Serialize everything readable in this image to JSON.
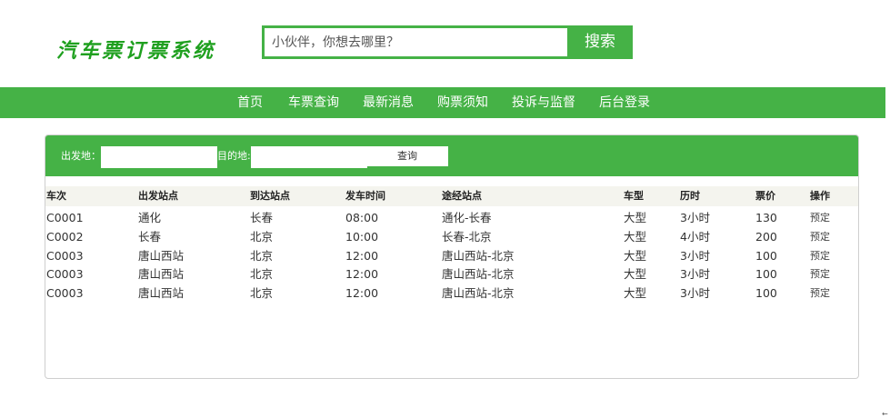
{
  "header": {
    "logo_text": "汽车票订票系统",
    "search_placeholder": "小伙伴，你想去哪里？",
    "search_button": "搜索"
  },
  "nav": {
    "items": [
      "首页",
      "车票查询",
      "最新消息",
      "购票须知",
      "投诉与监督",
      "后台登录"
    ]
  },
  "query": {
    "from_label": "出发地：",
    "to_label": "目的地:",
    "from_value": "",
    "to_value": "",
    "button": "查询"
  },
  "table": {
    "headers": [
      "车次",
      "出发站点",
      "到达站点",
      "发车时间",
      "途经站点",
      "车型",
      "历时",
      "票价",
      "操作"
    ],
    "rows": [
      [
        "C0001",
        "通化",
        "长春",
        "08:00",
        "通化-长春",
        "大型",
        "3小时",
        "130",
        "预定"
      ],
      [
        "C0002",
        "长春",
        "北京",
        "10:00",
        "长春-北京",
        "大型",
        "4小时",
        "200",
        "预定"
      ],
      [
        "C0003",
        "唐山西站",
        "北京",
        "12:00",
        "唐山西站-北京",
        "大型",
        "3小时",
        "100",
        "预定"
      ],
      [
        "C0003",
        "唐山西站",
        "北京",
        "12:00",
        "唐山西站-北京",
        "大型",
        "3小时",
        "100",
        "预定"
      ],
      [
        "C0003",
        "唐山西站",
        "北京",
        "12:00",
        "唐山西站-北京",
        "大型",
        "3小时",
        "100",
        "预定"
      ]
    ]
  },
  "colors": {
    "accent": "#45b246",
    "logo": "#1fa01f"
  }
}
